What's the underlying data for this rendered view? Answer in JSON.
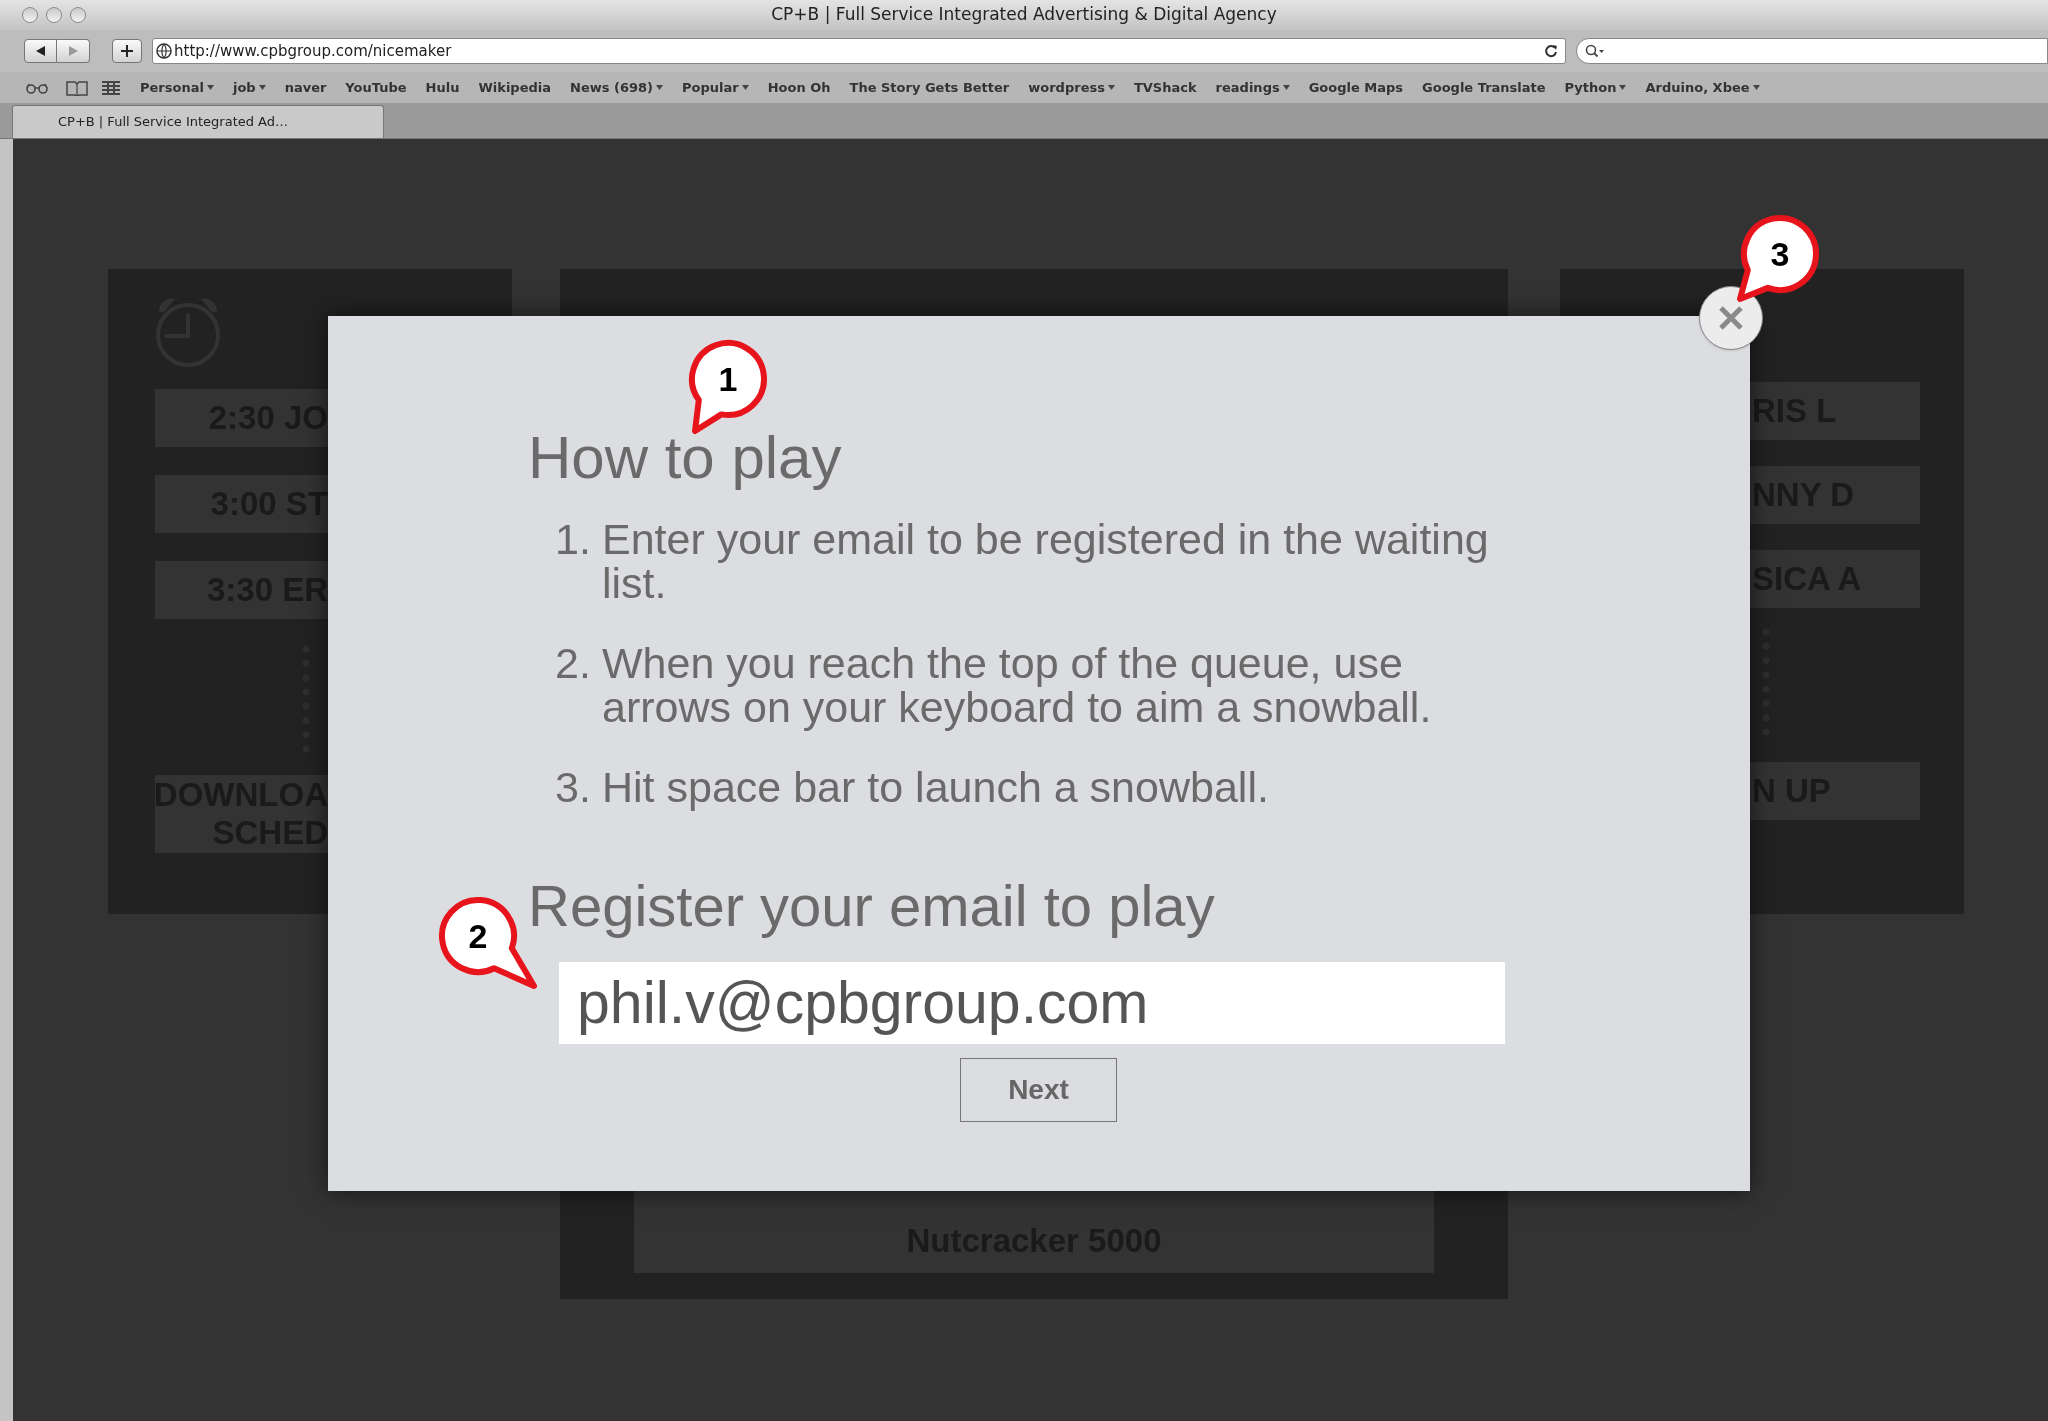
{
  "browser": {
    "title": "CP+B | Full Service Integrated Advertising & Digital Agency",
    "url": "http://www.cpbgroup.com/nicemaker",
    "bookmarks": [
      {
        "label": "Personal",
        "menu": true
      },
      {
        "label": "job",
        "menu": true
      },
      {
        "label": "naver",
        "menu": false
      },
      {
        "label": "YouTube",
        "menu": false
      },
      {
        "label": "Hulu",
        "menu": false
      },
      {
        "label": "Wikipedia",
        "menu": false
      },
      {
        "label": "News (698)",
        "menu": true
      },
      {
        "label": "Popular",
        "menu": true
      },
      {
        "label": "Hoon Oh",
        "menu": false
      },
      {
        "label": "The Story Gets Better",
        "menu": false
      },
      {
        "label": "wordpress",
        "menu": true
      },
      {
        "label": "TVShack",
        "menu": false
      },
      {
        "label": "readings",
        "menu": true
      },
      {
        "label": "Google Maps",
        "menu": false
      },
      {
        "label": "Google Translate",
        "menu": false
      },
      {
        "label": "Python",
        "menu": true
      },
      {
        "label": "Arduino, Xbee",
        "menu": true
      }
    ],
    "tabs": [
      {
        "label": "CP+B | Full Service Integrated Ad…",
        "selected": true
      }
    ]
  },
  "background": {
    "left_panel": {
      "items": [
        "2:30 JO",
        "3:00 ST",
        "3:30 ER"
      ],
      "button": [
        "DOWNLOA",
        "SCHED"
      ]
    },
    "center_panel": {
      "button": "Nutcracker 5000"
    },
    "right_panel": {
      "items": [
        "RIS L",
        "NNY D",
        "SICA A"
      ],
      "button": "N UP"
    }
  },
  "modal": {
    "title": "How to play",
    "steps": [
      {
        "number": "1.",
        "text": "Enter your email to be registered in the waiting list."
      },
      {
        "number": "2.",
        "text": "When you reach the top of the queue, use arrows on your keyboard to aim a snowball."
      },
      {
        "number": "3.",
        "text": "Hit space bar to launch a snowball."
      }
    ],
    "register_heading": "Register your email to play",
    "email": {
      "value": "phil.v@cpbgroup.com"
    },
    "next_button": "Next"
  },
  "callouts": [
    "1",
    "2",
    "3"
  ]
}
